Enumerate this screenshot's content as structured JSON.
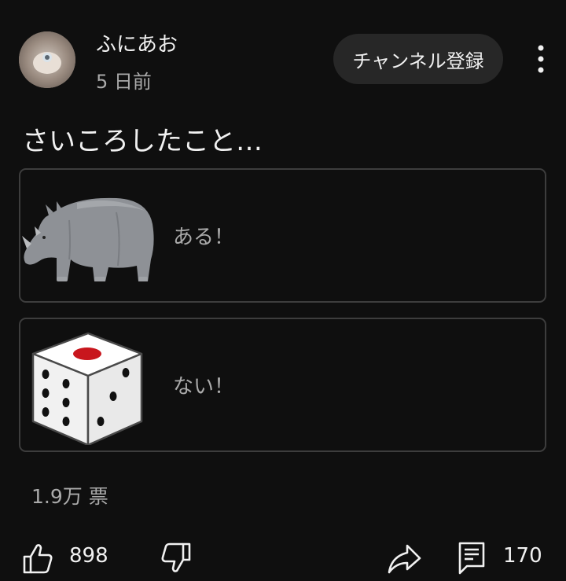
{
  "post": {
    "channel_name": "ふにあお",
    "time_ago": "5 日前",
    "subscribe_label": "チャンネル登録",
    "question": "さいころしたこと…"
  },
  "poll": {
    "options": [
      {
        "label": "ある！",
        "image": "rhinoceros-illustration"
      },
      {
        "label": "ない！",
        "image": "dice-illustration"
      }
    ],
    "votes_label": "1.9万 票"
  },
  "actions": {
    "like_count": "898",
    "comment_count": "170"
  },
  "icons": [
    "avatar-image",
    "more-vert-icon",
    "thumbs-up-icon",
    "thumbs-down-icon",
    "share-icon",
    "comment-icon"
  ],
  "colors": {
    "background": "#0f0f0f",
    "text": "#f1f1f1",
    "secondary_text": "#aaaaaa",
    "subscribe_bg": "#272727",
    "option_border": "#3d3d3d",
    "dice_pip_red": "#c8161d"
  }
}
